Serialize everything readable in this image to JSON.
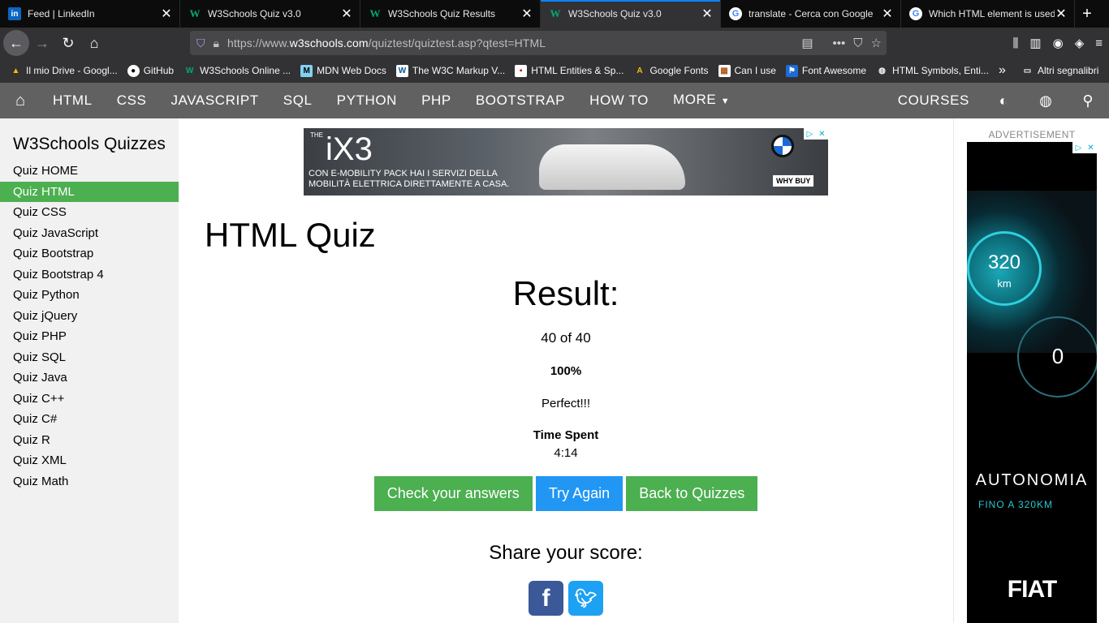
{
  "browser": {
    "tabs": [
      {
        "title": "Feed | LinkedIn",
        "icon": "linkedin-icon",
        "active": false
      },
      {
        "title": "W3Schools Quiz v3.0",
        "icon": "w3schools-icon",
        "active": false
      },
      {
        "title": "W3Schools Quiz Results",
        "icon": "w3schools-icon",
        "active": false
      },
      {
        "title": "W3Schools Quiz v3.0",
        "icon": "w3schools-icon",
        "active": true
      },
      {
        "title": "translate - Cerca con Google",
        "icon": "google-icon",
        "active": false
      },
      {
        "title": "Which HTML element is used to",
        "icon": "google-icon",
        "active": false
      }
    ],
    "url_prefix": "https://www.",
    "url_host": "w3schools.com",
    "url_path": "/quiztest/quiztest.asp?qtest=HTML",
    "bookmarks": [
      {
        "label": "Il mio Drive - Googl...",
        "icon": "google-drive-icon"
      },
      {
        "label": "GitHub",
        "icon": "github-icon"
      },
      {
        "label": "W3Schools Online ...",
        "icon": "w3schools-icon"
      },
      {
        "label": "MDN Web Docs",
        "icon": "mdn-icon"
      },
      {
        "label": "The W3C Markup V...",
        "icon": "w3c-icon"
      },
      {
        "label": "HTML Entities & Sp...",
        "icon": "page-icon"
      },
      {
        "label": "Google Fonts",
        "icon": "google-fonts-icon"
      },
      {
        "label": "Can I use",
        "icon": "caniuse-icon"
      },
      {
        "label": "Font Awesome",
        "icon": "flag-icon"
      },
      {
        "label": "HTML Symbols, Enti...",
        "icon": "globe-icon"
      }
    ],
    "bookmarks_folder": "Altri segnalibri"
  },
  "w3nav": {
    "items": [
      "HTML",
      "CSS",
      "JAVASCRIPT",
      "SQL",
      "PYTHON",
      "PHP",
      "BOOTSTRAP",
      "HOW TO",
      "MORE"
    ],
    "courses": "COURSES"
  },
  "sidebar": {
    "title": "W3Schools Quizzes",
    "items": [
      {
        "label": "Quiz HOME",
        "active": false
      },
      {
        "label": "Quiz HTML",
        "active": true
      },
      {
        "label": "Quiz CSS",
        "active": false
      },
      {
        "label": "Quiz JavaScript",
        "active": false
      },
      {
        "label": "Quiz Bootstrap",
        "active": false
      },
      {
        "label": "Quiz Bootstrap 4",
        "active": false
      },
      {
        "label": "Quiz Python",
        "active": false
      },
      {
        "label": "Quiz jQuery",
        "active": false
      },
      {
        "label": "Quiz PHP",
        "active": false
      },
      {
        "label": "Quiz SQL",
        "active": false
      },
      {
        "label": "Quiz Java",
        "active": false
      },
      {
        "label": "Quiz C++",
        "active": false
      },
      {
        "label": "Quiz C#",
        "active": false
      },
      {
        "label": "Quiz R",
        "active": false
      },
      {
        "label": "Quiz XML",
        "active": false
      },
      {
        "label": "Quiz Math",
        "active": false
      }
    ]
  },
  "banner_ad": {
    "brand_prefix": "THE",
    "model": "iX3",
    "tagline_1": "CON E-MOBILITY PACK HAI I SERVIZI DELLA",
    "tagline_2": "MOBILITÀ ELETTRICA DIRETTAMENTE A CASA.",
    "cta": "WHY BUY"
  },
  "main": {
    "title": "HTML Quiz",
    "result_heading": "Result:",
    "score": "40 of 40",
    "percent": "100%",
    "verdict": "Perfect!!!",
    "time_label": "Time Spent",
    "time_value": "4:14",
    "buttons": {
      "check": "Check your answers",
      "retry": "Try Again",
      "back": "Back to Quizzes"
    },
    "share_label": "Share your score:"
  },
  "side_ad": {
    "label": "ADVERTISEMENT",
    "range_value": "320",
    "range_unit": "km",
    "speed": "0",
    "headline": "AUTONOMIA",
    "subline": "FINO A 320KM",
    "brand": "FIAT"
  },
  "colors": {
    "w3_green": "#4caf50",
    "w3_blue": "#2196f3",
    "nav_gray": "#616161",
    "tab_accent": "#0a84ff"
  }
}
